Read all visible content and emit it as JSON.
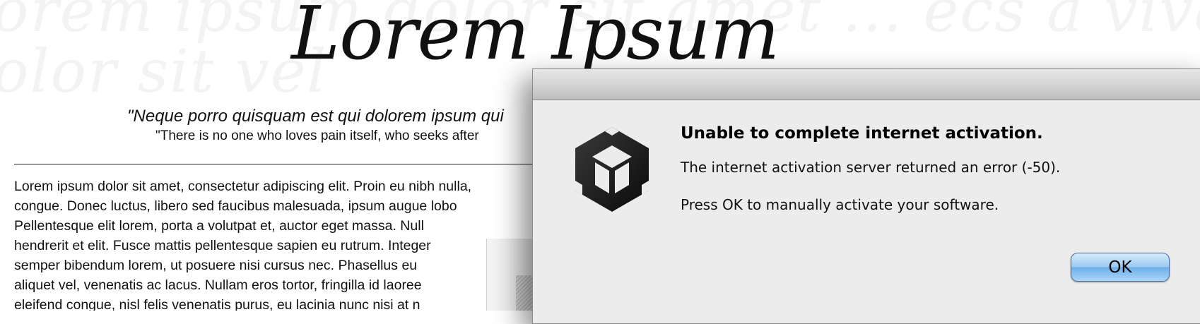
{
  "page": {
    "watermark_lines": [
      "orem ipsum dolor sit amet ... ecs a vivamus! Lorem",
      "olor sit vel"
    ],
    "logo_title": "Lorem Ipsum",
    "quote_latin": "\"Neque porro quisquam est qui dolorem ipsum qui",
    "quote_english": "\"There is no one who loves pain itself, who seeks after",
    "body_lines": [
      "Lorem ipsum dolor sit amet, consectetur adipiscing elit. Proin eu nibh nulla,",
      "congue. Donec luctus, libero sed faucibus malesuada, ipsum augue lobo",
      "Pellentesque elit lorem, porta a volutpat et, auctor eget massa. Null",
      "hendrerit et elit. Fusce mattis pellentesque sapien eu rutrum. Integer",
      "semper bibendum lorem, ut posuere nisi cursus nec. Phasellus eu",
      "aliquet vel, venenatis ac lacus. Nullam eros tortor, fringilla id laoree",
      "eleifend congue, nisl felis venenatis purus, eu lacinia nunc nisi at n"
    ]
  },
  "dialog": {
    "icon": "unity-logo-icon",
    "title": "Unable to complete internet activation.",
    "message_line_1": "The internet activation server returned an error (-50).",
    "message_line_2": "Press OK to manually activate your software.",
    "ok_label": "OK"
  },
  "colors": {
    "dialog_bg": "#ececec",
    "button_blue": "#9ccaf2",
    "text": "#000000"
  }
}
